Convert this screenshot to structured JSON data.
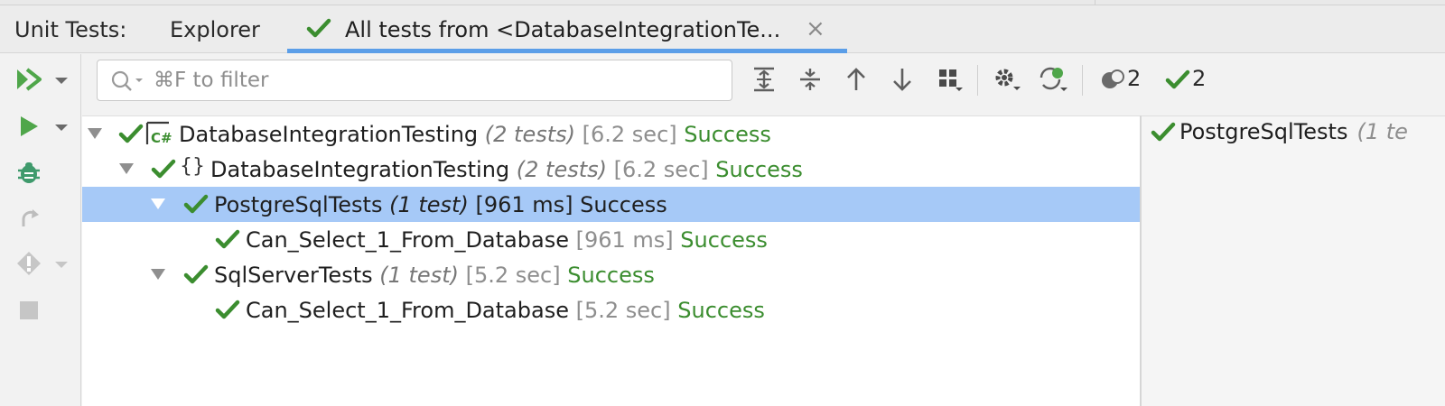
{
  "panel": {
    "caption": "Unit Tests:",
    "explorer_tab": "Explorer",
    "active_tab": {
      "label": "All tests from <DatabaseIntegrationTe...",
      "close": "×"
    }
  },
  "left_toolbar": {
    "icons": [
      "run-all-icon",
      "dropdown-icon",
      "run-icon",
      "dropdown-icon",
      "debug-icon",
      "rerun-icon",
      "cover-icon",
      "dropdown-icon",
      "stop-icon"
    ]
  },
  "toolbar": {
    "search_placeholder": "⌘F to filter",
    "icons": [
      "expand-all-icon",
      "collapse-all-icon",
      "previous-icon",
      "next-icon",
      "group-by-icon",
      "settings-icon",
      "track-running-icon"
    ],
    "ignored_count": "2",
    "passed_count": "2"
  },
  "tree": {
    "rows": [
      {
        "name": "DatabaseIntegrationTesting",
        "count": "(2 tests)",
        "time": "[6.2 sec]",
        "status": "Success",
        "icon": "csharp-project-icon"
      },
      {
        "name": "DatabaseIntegrationTesting",
        "count": "(2 tests)",
        "time": "[6.2 sec]",
        "status": "Success",
        "icon": "namespace-icon"
      },
      {
        "name": "PostgreSqlTests",
        "count": "(1 test)",
        "time": "[961 ms]",
        "status": "Success",
        "selected": true
      },
      {
        "name": "Can_Select_1_From_Database",
        "count": "",
        "time": "[961 ms]",
        "status": "Success"
      },
      {
        "name": "SqlServerTests",
        "count": "(1 test)",
        "time": "[5.2 sec]",
        "status": "Success"
      },
      {
        "name": "Can_Select_1_From_Database",
        "count": "",
        "time": "[5.2 sec]",
        "status": "Success"
      }
    ]
  },
  "details": {
    "title": "PostgreSqlTests",
    "subtitle": "(1 te"
  },
  "colors": {
    "success": "#3b8d2f",
    "selection": "#a6c9f7",
    "accent": "#5b9ee8",
    "run": "#4fa64a"
  }
}
